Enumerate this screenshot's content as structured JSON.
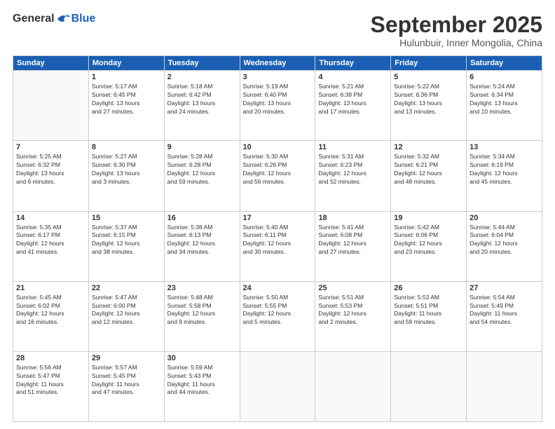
{
  "header": {
    "logo": {
      "general": "General",
      "blue": "Blue"
    },
    "title": "September 2025",
    "subtitle": "Hulunbuir, Inner Mongolia, China"
  },
  "weekdays": [
    "Sunday",
    "Monday",
    "Tuesday",
    "Wednesday",
    "Thursday",
    "Friday",
    "Saturday"
  ],
  "weeks": [
    [
      {
        "day": "",
        "info": ""
      },
      {
        "day": "1",
        "info": "Sunrise: 5:17 AM\nSunset: 6:45 PM\nDaylight: 13 hours\nand 27 minutes."
      },
      {
        "day": "2",
        "info": "Sunrise: 5:18 AM\nSunset: 6:42 PM\nDaylight: 13 hours\nand 24 minutes."
      },
      {
        "day": "3",
        "info": "Sunrise: 5:19 AM\nSunset: 6:40 PM\nDaylight: 13 hours\nand 20 minutes."
      },
      {
        "day": "4",
        "info": "Sunrise: 5:21 AM\nSunset: 6:38 PM\nDaylight: 13 hours\nand 17 minutes."
      },
      {
        "day": "5",
        "info": "Sunrise: 5:22 AM\nSunset: 6:36 PM\nDaylight: 13 hours\nand 13 minutes."
      },
      {
        "day": "6",
        "info": "Sunrise: 5:24 AM\nSunset: 6:34 PM\nDaylight: 13 hours\nand 10 minutes."
      }
    ],
    [
      {
        "day": "7",
        "info": "Sunrise: 5:25 AM\nSunset: 6:32 PM\nDaylight: 13 hours\nand 6 minutes."
      },
      {
        "day": "8",
        "info": "Sunrise: 5:27 AM\nSunset: 6:30 PM\nDaylight: 13 hours\nand 3 minutes."
      },
      {
        "day": "9",
        "info": "Sunrise: 5:28 AM\nSunset: 6:28 PM\nDaylight: 12 hours\nand 59 minutes."
      },
      {
        "day": "10",
        "info": "Sunrise: 5:30 AM\nSunset: 6:26 PM\nDaylight: 12 hours\nand 56 minutes."
      },
      {
        "day": "11",
        "info": "Sunrise: 5:31 AM\nSunset: 6:23 PM\nDaylight: 12 hours\nand 52 minutes."
      },
      {
        "day": "12",
        "info": "Sunrise: 5:32 AM\nSunset: 6:21 PM\nDaylight: 12 hours\nand 48 minutes."
      },
      {
        "day": "13",
        "info": "Sunrise: 5:34 AM\nSunset: 6:19 PM\nDaylight: 12 hours\nand 45 minutes."
      }
    ],
    [
      {
        "day": "14",
        "info": "Sunrise: 5:35 AM\nSunset: 6:17 PM\nDaylight: 12 hours\nand 41 minutes."
      },
      {
        "day": "15",
        "info": "Sunrise: 5:37 AM\nSunset: 6:15 PM\nDaylight: 12 hours\nand 38 minutes."
      },
      {
        "day": "16",
        "info": "Sunrise: 5:38 AM\nSunset: 6:13 PM\nDaylight: 12 hours\nand 34 minutes."
      },
      {
        "day": "17",
        "info": "Sunrise: 5:40 AM\nSunset: 6:11 PM\nDaylight: 12 hours\nand 30 minutes."
      },
      {
        "day": "18",
        "info": "Sunrise: 5:41 AM\nSunset: 6:08 PM\nDaylight: 12 hours\nand 27 minutes."
      },
      {
        "day": "19",
        "info": "Sunrise: 5:42 AM\nSunset: 6:06 PM\nDaylight: 12 hours\nand 23 minutes."
      },
      {
        "day": "20",
        "info": "Sunrise: 5:44 AM\nSunset: 6:04 PM\nDaylight: 12 hours\nand 20 minutes."
      }
    ],
    [
      {
        "day": "21",
        "info": "Sunrise: 5:45 AM\nSunset: 6:02 PM\nDaylight: 12 hours\nand 16 minutes."
      },
      {
        "day": "22",
        "info": "Sunrise: 5:47 AM\nSunset: 6:00 PM\nDaylight: 12 hours\nand 12 minutes."
      },
      {
        "day": "23",
        "info": "Sunrise: 5:48 AM\nSunset: 5:58 PM\nDaylight: 12 hours\nand 9 minutes."
      },
      {
        "day": "24",
        "info": "Sunrise: 5:50 AM\nSunset: 5:55 PM\nDaylight: 12 hours\nand 5 minutes."
      },
      {
        "day": "25",
        "info": "Sunrise: 5:51 AM\nSunset: 5:53 PM\nDaylight: 12 hours\nand 2 minutes."
      },
      {
        "day": "26",
        "info": "Sunrise: 5:53 AM\nSunset: 5:51 PM\nDaylight: 11 hours\nand 58 minutes."
      },
      {
        "day": "27",
        "info": "Sunrise: 5:54 AM\nSunset: 5:49 PM\nDaylight: 11 hours\nand 54 minutes."
      }
    ],
    [
      {
        "day": "28",
        "info": "Sunrise: 5:56 AM\nSunset: 5:47 PM\nDaylight: 11 hours\nand 51 minutes."
      },
      {
        "day": "29",
        "info": "Sunrise: 5:57 AM\nSunset: 5:45 PM\nDaylight: 11 hours\nand 47 minutes."
      },
      {
        "day": "30",
        "info": "Sunrise: 5:59 AM\nSunset: 5:43 PM\nDaylight: 11 hours\nand 44 minutes."
      },
      {
        "day": "",
        "info": ""
      },
      {
        "day": "",
        "info": ""
      },
      {
        "day": "",
        "info": ""
      },
      {
        "day": "",
        "info": ""
      }
    ]
  ]
}
